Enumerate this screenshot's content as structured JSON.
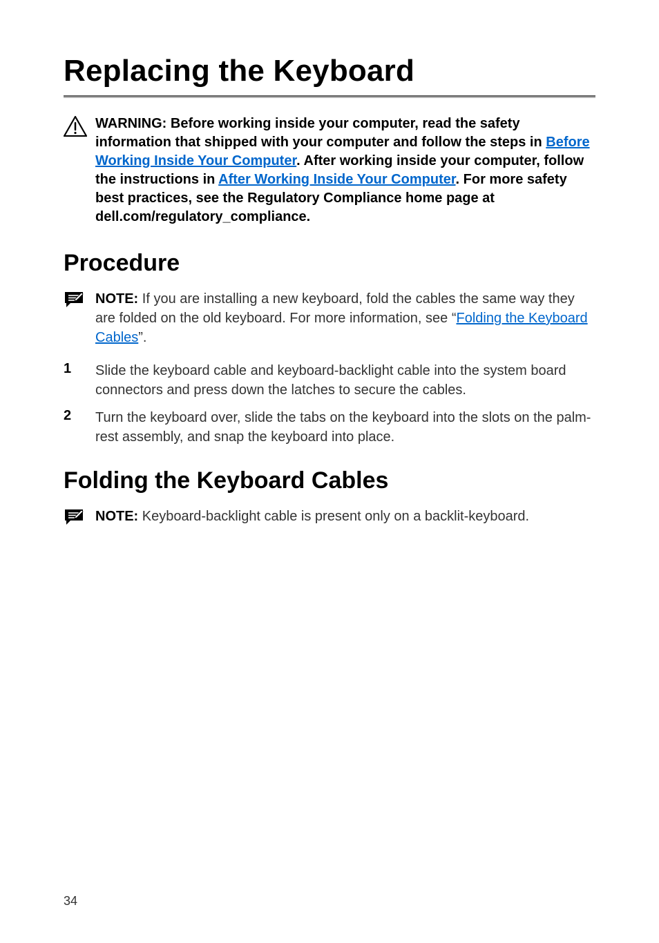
{
  "title": "Replacing the Keyboard",
  "warning": {
    "prefix": "WARNING: ",
    "part1": "Before working inside your computer, read the safety information that shipped with your computer and follow the steps in ",
    "link1": "Before Working Inside Your Computer",
    "part2": ". After working inside your computer, follow the instructions in ",
    "link2": "After Working Inside Your Computer",
    "part3": ". For more safety best practices, see the Regulatory Compliance home page at dell.com/regulatory_compliance."
  },
  "procedure_heading": "Procedure",
  "note1": {
    "prefix": "NOTE: ",
    "part1": "If you are installing a new keyboard, fold the cables the same way they are folded on the old keyboard. For more information, see “",
    "link": "Folding the Keyboard Cables",
    "part2": "”."
  },
  "steps": [
    {
      "num": "1",
      "text": "Slide the keyboard cable and keyboard-backlight cable into the system board connectors and press down the latches to secure the cables."
    },
    {
      "num": "2",
      "text": "Turn the keyboard over, slide the tabs on the keyboard into the slots on the palm-rest assembly, and snap the keyboard into place."
    }
  ],
  "folding_heading": "Folding the Keyboard Cables",
  "note2": {
    "prefix": "NOTE: ",
    "text": "Keyboard-backlight cable is present only on a backlit-keyboard."
  },
  "page_number": "34"
}
